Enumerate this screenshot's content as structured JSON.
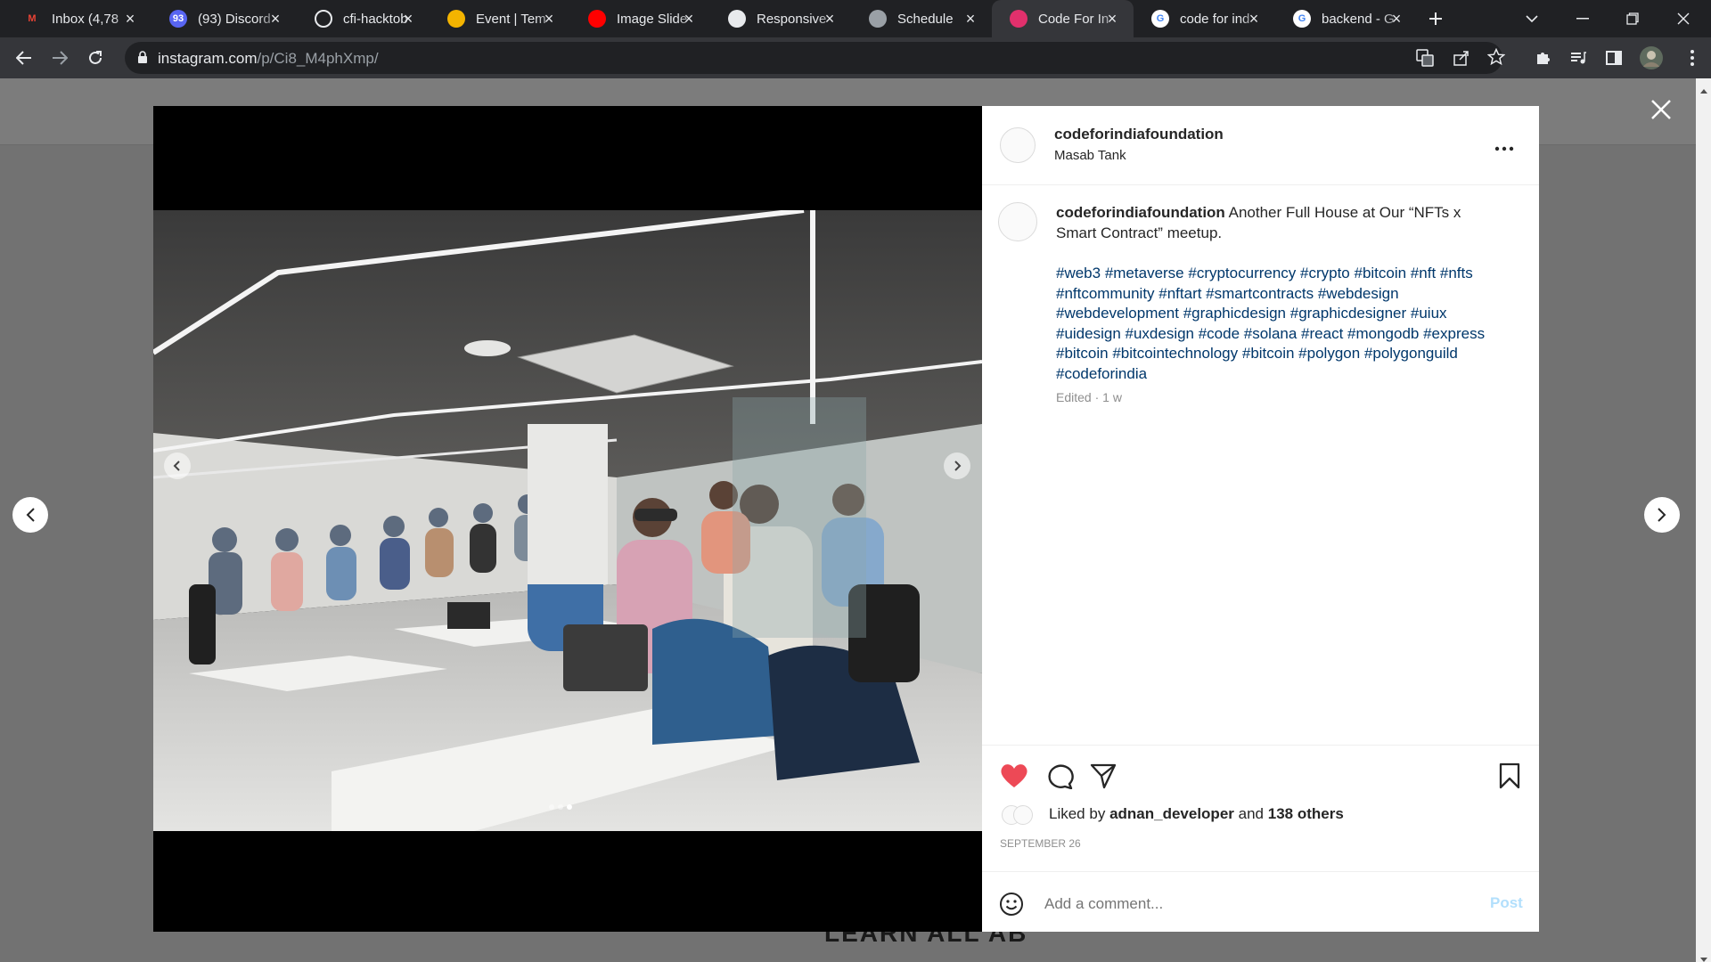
{
  "browser": {
    "tabs": [
      {
        "title": "Inbox (4,78",
        "icon": "gmail-icon",
        "badge": "M",
        "color": "#ea4335"
      },
      {
        "title": "(93) Discord",
        "icon": "discord-icon",
        "badge": "93",
        "color": "#5865f2"
      },
      {
        "title": "cfi-hacktob",
        "icon": "github-icon",
        "badge": "",
        "color": "#e8eaed"
      },
      {
        "title": "Event | Tem",
        "icon": "event-icon",
        "badge": "",
        "color": "#f4b400"
      },
      {
        "title": "Image Slide",
        "icon": "youtube-icon",
        "badge": "",
        "color": "#ff0000"
      },
      {
        "title": "Responsive",
        "icon": "codepen-icon",
        "badge": "",
        "color": "#e8eaed"
      },
      {
        "title": "Schedule",
        "icon": "globe-icon",
        "badge": "",
        "color": "#9aa0a6"
      },
      {
        "title": "Code For In",
        "icon": "instagram-icon",
        "badge": "",
        "color": "#e1306c"
      },
      {
        "title": "code for ind",
        "icon": "google-icon",
        "badge": "G",
        "color": "#ffffff"
      },
      {
        "title": "backend - G",
        "icon": "google-icon",
        "badge": "G",
        "color": "#ffffff"
      }
    ],
    "active_tab": 7,
    "url_host": "instagram.com",
    "url_path": "/p/Ci8_M4phXmp/"
  },
  "page": {
    "background_text": "LEARN ALL AB"
  },
  "post": {
    "username": "codeforindiafoundation",
    "location": "Masab Tank",
    "caption_user": "codeforindiafoundation",
    "caption_line1": "Another Full House at Our “NFTs x",
    "caption_line2": "Smart Contract” meetup.",
    "hashtag_lines": [
      "#web3 #metaverse #cryptocurrency #crypto #bitcoin #nft #nfts",
      "#nftcommunity #nftart #smartcontracts #webdesign",
      "#webdevelopment #graphicdesign #graphicdesigner #uiux",
      "#uidesign #uxdesign #code #solana #react #mongodb #express",
      "#bitcoin #bitcointechnology #bitcoin #polygon #polygonguild",
      "#codeforindia"
    ],
    "edited": "Edited · 1 w",
    "liked_by_prefix": "Liked by",
    "liked_by_user": "adnan_developer",
    "liked_by_and": "and",
    "liked_by_others": "138 others",
    "date": "SEPTEMBER 26",
    "comment_placeholder": "Add a comment...",
    "post_button": "Post",
    "carousel": {
      "count": 3,
      "active": 3
    }
  },
  "colors": {
    "like": "#ed4956",
    "link": "#00376b",
    "post_button": "#b2dffc"
  }
}
